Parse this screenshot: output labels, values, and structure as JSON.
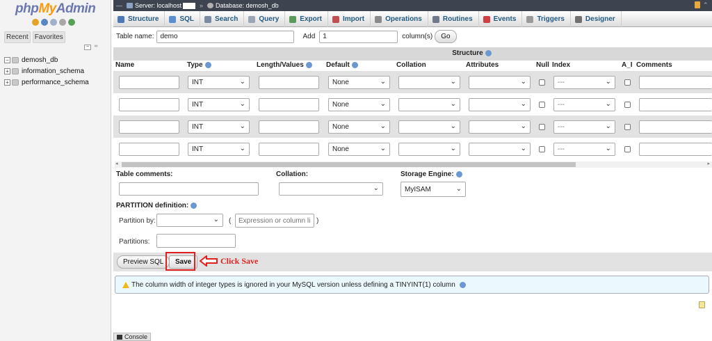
{
  "nav": {
    "logo_php": "php",
    "logo_my": "My",
    "logo_admin": "Admin",
    "tabs": [
      "Recent",
      "Favorites"
    ],
    "databases": [
      "demosh_db",
      "information_schema",
      "performance_schema"
    ]
  },
  "breadcrumb": {
    "server": "Server: localhost",
    "separator": "»",
    "database": "Database: demosh_db"
  },
  "tabs": [
    {
      "label": "Structure",
      "color": "#4a79b6"
    },
    {
      "label": "SQL",
      "color": "#5b8ed0"
    },
    {
      "label": "Search",
      "color": "#7a8aa0"
    },
    {
      "label": "Query",
      "color": "#9aa6b5"
    },
    {
      "label": "Export",
      "color": "#5a9a5a"
    },
    {
      "label": "Import",
      "color": "#c05050"
    },
    {
      "label": "Operations",
      "color": "#8a8a8a"
    },
    {
      "label": "Routines",
      "color": "#707a8a"
    },
    {
      "label": "Events",
      "color": "#d04040"
    },
    {
      "label": "Triggers",
      "color": "#9a9a9a"
    },
    {
      "label": "Designer",
      "color": "#707070"
    }
  ],
  "form": {
    "table_name_label": "Table name:",
    "table_name_value": "demo",
    "add_label": "Add",
    "add_value": "1",
    "columns_label": "column(s)",
    "go_label": "Go"
  },
  "structure": {
    "title": "Structure",
    "headers": {
      "name": "Name",
      "type": "Type",
      "length": "Length/Values",
      "default": "Default",
      "collation": "Collation",
      "attributes": "Attributes",
      "null": "Null",
      "index": "Index",
      "ai": "A_I",
      "comments": "Comments"
    },
    "rows": [
      {
        "type": "INT",
        "default": "None",
        "index": "---"
      },
      {
        "type": "INT",
        "default": "None",
        "index": "---"
      },
      {
        "type": "INT",
        "default": "None",
        "index": "---"
      },
      {
        "type": "INT",
        "default": "None",
        "index": "---"
      }
    ]
  },
  "table_options": {
    "comments_label": "Table comments:",
    "collation_label": "Collation:",
    "engine_label": "Storage Engine:",
    "engine_value": "MyISAM"
  },
  "partition": {
    "title": "PARTITION definition:",
    "partition_by_label": "Partition by:",
    "open_paren": "(",
    "close_paren": ")",
    "expression_placeholder": "Expression or column list",
    "partitions_label": "Partitions:"
  },
  "actions": {
    "preview_sql": "Preview SQL",
    "save": "Save",
    "annotation": "Click Save",
    "annotation_color": "#d22222"
  },
  "notice": {
    "text": "The column width of integer types is ignored in your MySQL version unless defining a TINYINT(1) column"
  },
  "console": {
    "label": "Console"
  }
}
